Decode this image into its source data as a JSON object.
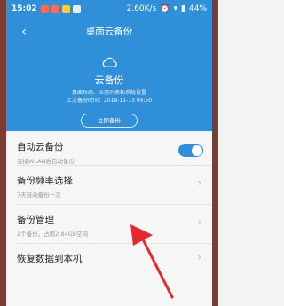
{
  "status_bar": {
    "time": "15:02",
    "speed": "2.60K/s",
    "battery": "44%"
  },
  "header": {
    "back_glyph": "‹",
    "title": "桌面云备份"
  },
  "hero": {
    "icon": "cloud-icon",
    "label": "云备份",
    "description": "桌面布局、应用列表和系统设置",
    "last_backup": "上次备份时间：2018-11-13 04:50",
    "backup_button_label": "立即备份"
  },
  "settings": {
    "auto_backup": {
      "title": "自动云备份",
      "subtitle": "连接WLAN后自动备份",
      "enabled": true
    },
    "backup_frequency": {
      "title": "备份频率选择",
      "subtitle": "7天自动备份一次"
    },
    "backup_management": {
      "title": "备份管理",
      "subtitle": "2个备份，占用2.84GB空间"
    },
    "restore": {
      "title": "恢复数据到本机"
    }
  },
  "colors": {
    "accent": "#2f8fd8",
    "arrow": "#e8262b"
  }
}
